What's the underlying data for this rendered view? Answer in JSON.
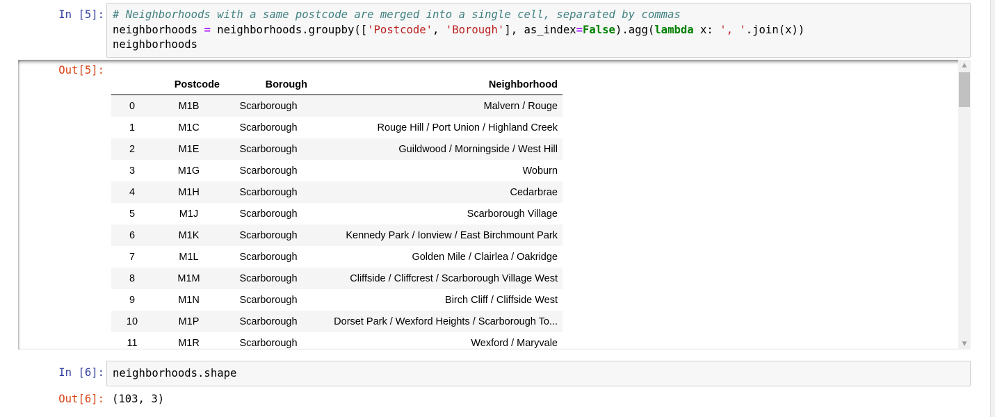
{
  "cells": {
    "in5": {
      "prompt": "In [5]:",
      "comment": "# Neighborhoods with a same postcode are merged into a single cell, separated by commas",
      "line2": {
        "a": "neighborhoods ",
        "eq": "=",
        "b": " neighborhoods.groupby([",
        "s1": "'Postcode'",
        "c": ", ",
        "s2": "'Borough'",
        "d": "], as_index",
        "eq2": "=",
        "kwFalse": "False",
        "e": ").agg(",
        "kwLambda": "lambda",
        "f": " x: ",
        "s3": "', '",
        "g": ".join(x))"
      },
      "line3": "neighborhoods"
    },
    "out5": {
      "prompt": "Out[5]:",
      "columns": [
        "",
        "Postcode",
        "Borough",
        "Neighborhood"
      ],
      "rows": [
        [
          "0",
          "M1B",
          "Scarborough",
          "Malvern / Rouge"
        ],
        [
          "1",
          "M1C",
          "Scarborough",
          "Rouge Hill / Port Union / Highland Creek"
        ],
        [
          "2",
          "M1E",
          "Scarborough",
          "Guildwood / Morningside / West Hill"
        ],
        [
          "3",
          "M1G",
          "Scarborough",
          "Woburn"
        ],
        [
          "4",
          "M1H",
          "Scarborough",
          "Cedarbrae"
        ],
        [
          "5",
          "M1J",
          "Scarborough",
          "Scarborough Village"
        ],
        [
          "6",
          "M1K",
          "Scarborough",
          "Kennedy Park / Ionview / East Birchmount Park"
        ],
        [
          "7",
          "M1L",
          "Scarborough",
          "Golden Mile / Clairlea / Oakridge"
        ],
        [
          "8",
          "M1M",
          "Scarborough",
          "Cliffside / Cliffcrest / Scarborough Village West"
        ],
        [
          "9",
          "M1N",
          "Scarborough",
          "Birch Cliff / Cliffside West"
        ],
        [
          "10",
          "M1P",
          "Scarborough",
          "Dorset Park / Wexford Heights / Scarborough To..."
        ],
        [
          "11",
          "M1R",
          "Scarborough",
          "Wexford / Maryvale"
        ]
      ]
    },
    "in6": {
      "prompt": "In [6]:",
      "code": "neighborhoods.shape"
    },
    "out6": {
      "prompt": "Out[6]:",
      "result": "(103, 3)"
    }
  },
  "scrollbar": {
    "up_icon": "triangle-up",
    "down_icon": "triangle-down"
  },
  "colors": {
    "prompt_in": "#303f9f",
    "prompt_out": "#d84315",
    "comment": "#408080",
    "string": "#ba2121",
    "keyword": "#008000",
    "operator": "#aa22ff"
  }
}
